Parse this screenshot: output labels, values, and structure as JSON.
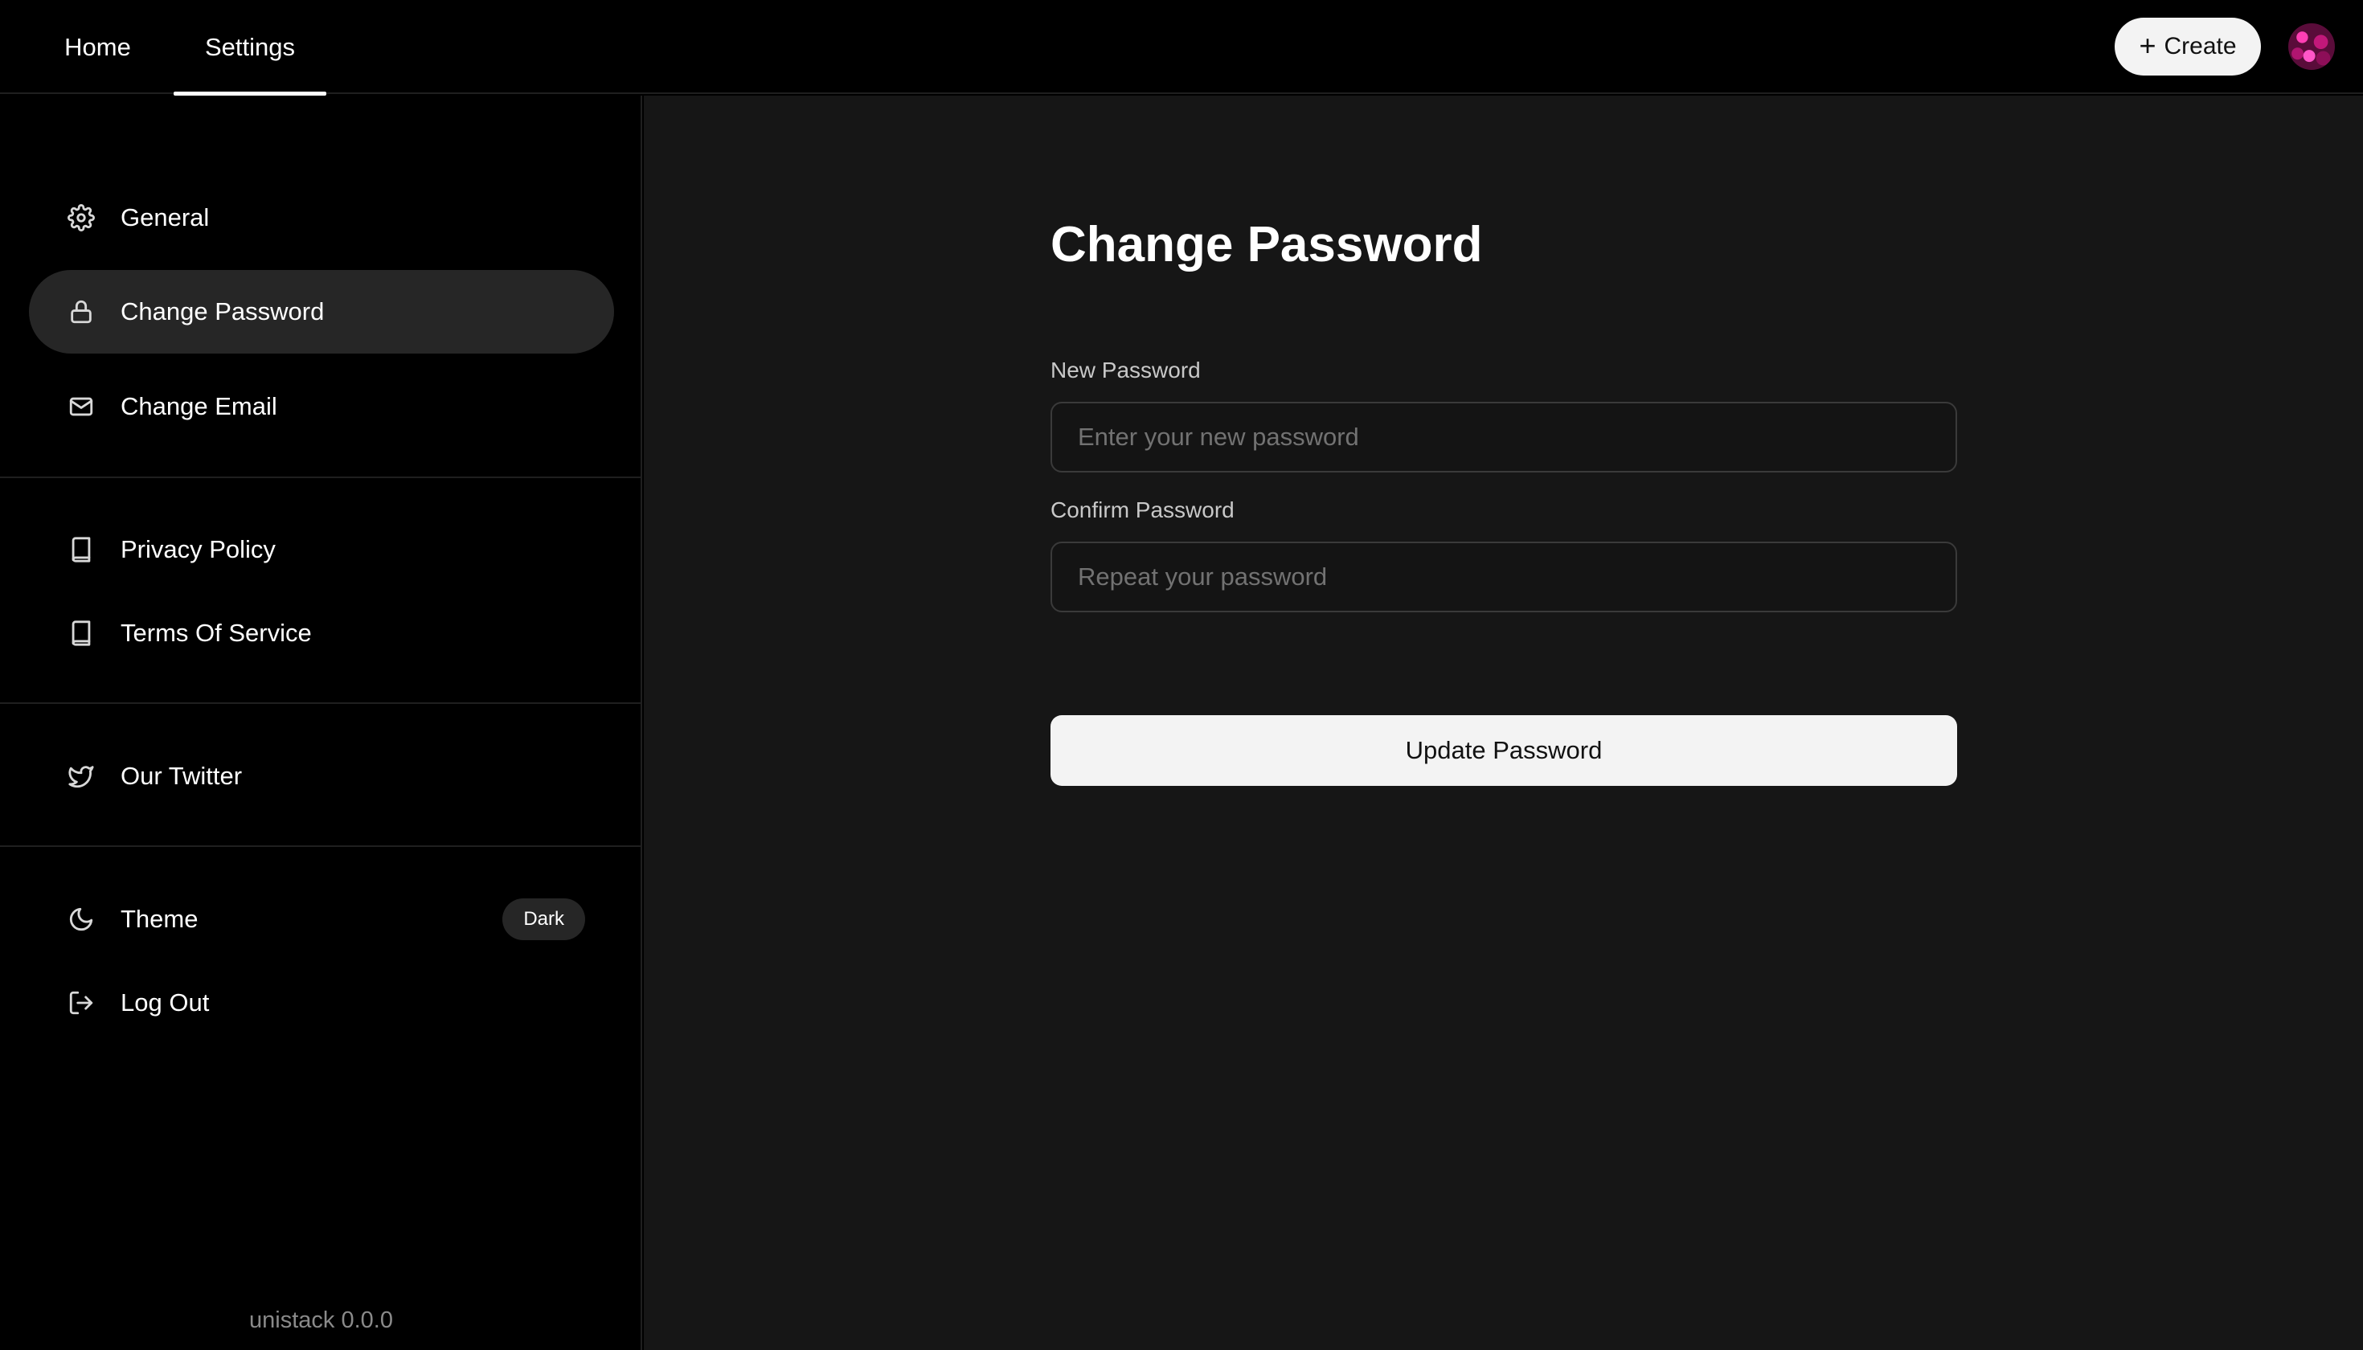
{
  "header": {
    "tabs": [
      {
        "label": "Home"
      },
      {
        "label": "Settings"
      }
    ],
    "create_label": "Create"
  },
  "sidebar": {
    "groups": [
      [
        {
          "label": "General",
          "icon": "gear-icon"
        },
        {
          "label": "Change Password",
          "icon": "lock-icon",
          "active": true
        },
        {
          "label": "Change Email",
          "icon": "mail-icon"
        }
      ],
      [
        {
          "label": "Privacy Policy",
          "icon": "book-icon"
        },
        {
          "label": "Terms Of Service",
          "icon": "book-icon"
        }
      ],
      [
        {
          "label": "Our Twitter",
          "icon": "twitter-icon"
        }
      ],
      [
        {
          "label": "Theme",
          "icon": "moon-icon",
          "badge": "Dark"
        },
        {
          "label": "Log Out",
          "icon": "logout-icon"
        }
      ]
    ],
    "version": "unistack 0.0.0"
  },
  "main": {
    "title": "Change Password",
    "new_password": {
      "label": "New Password",
      "placeholder": "Enter your new password",
      "value": ""
    },
    "confirm_password": {
      "label": "Confirm Password",
      "placeholder": "Repeat your password",
      "value": ""
    },
    "submit_label": "Update Password"
  },
  "colors": {
    "background": "#000000",
    "main_panel": "#161616",
    "active_item": "#262626",
    "button": "#f3f3f3"
  }
}
